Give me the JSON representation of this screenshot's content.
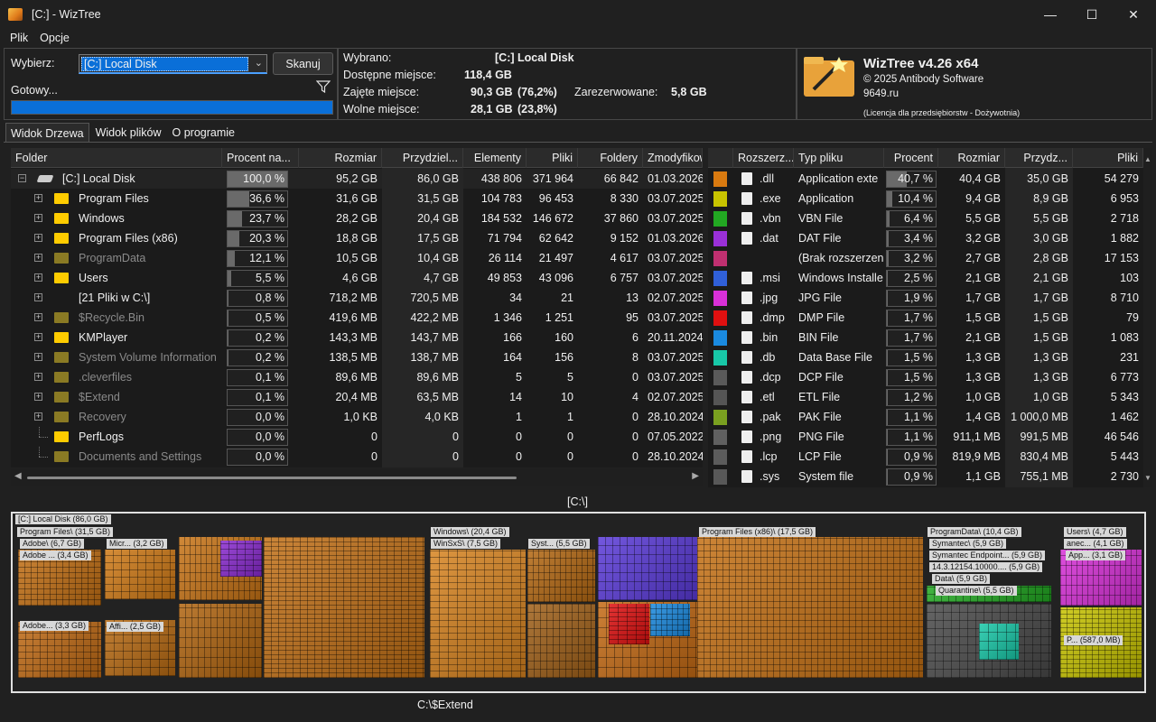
{
  "window": {
    "title": "[C:]  - WizTree",
    "minimize": "—",
    "maximize": "☐",
    "close": "✕"
  },
  "menu": [
    "Plik",
    "Opcje"
  ],
  "scan": {
    "select_label": "Wybierz:",
    "drive": "[C:] Local Disk",
    "scan_button": "Skanuj",
    "status": "Gotowy...",
    "progress": 1.0
  },
  "info": {
    "selected_label": "Wybrano:",
    "selected_drive": "[C:]",
    "selected_name": "Local Disk",
    "available_label": "Dostępne miejsce:",
    "available": "118,4 GB",
    "used_label": "Zajęte miejsce:",
    "used": "90,3 GB",
    "used_pct": "(76,2%)",
    "reserved_label": "Zarezerwowane:",
    "reserved": "5,8 GB",
    "free_label": "Wolne miejsce:",
    "free": "28,1 GB",
    "free_pct": "(23,8%)"
  },
  "about": {
    "title": "WizTree v4.26 x64",
    "copyright": "© 2025 Antibody Software",
    "site": "9649.ru",
    "license": "(Licencja dla przedsiębiorstw - Dożywotnia)"
  },
  "tabs": [
    "Widok Drzewa",
    "Widok plików",
    "O programie"
  ],
  "tree": {
    "columns": [
      "Folder",
      "Procent na...",
      "Rozmiar",
      "Przydziel...",
      "Elementy",
      "Pliki",
      "Foldery",
      "Zmodyfikow"
    ],
    "rows": [
      {
        "name": "[C:] Local Disk",
        "pct": "100,0 %",
        "pctv": 1.0,
        "size": "95,2 GB",
        "alloc": "86,0 GB",
        "items": "438 806",
        "files": "371 964",
        "folders": "66 842",
        "mod": "01.03.2026",
        "level": 0,
        "exp": "−",
        "icon": "drive",
        "dim": false
      },
      {
        "name": "Program Files",
        "pct": "36,6 %",
        "pctv": 0.366,
        "size": "31,6 GB",
        "alloc": "31,5 GB",
        "items": "104 783",
        "files": "96 453",
        "folders": "8 330",
        "mod": "03.07.2025",
        "level": 1,
        "exp": "+",
        "icon": "folder",
        "dim": false
      },
      {
        "name": "Windows",
        "pct": "23,7 %",
        "pctv": 0.237,
        "size": "28,2 GB",
        "alloc": "20,4 GB",
        "items": "184 532",
        "files": "146 672",
        "folders": "37 860",
        "mod": "03.07.2025",
        "level": 1,
        "exp": "+",
        "icon": "folder",
        "dim": false
      },
      {
        "name": "Program Files (x86)",
        "pct": "20,3 %",
        "pctv": 0.203,
        "size": "18,8 GB",
        "alloc": "17,5 GB",
        "items": "71 794",
        "files": "62 642",
        "folders": "9 152",
        "mod": "01.03.2026",
        "level": 1,
        "exp": "+",
        "icon": "folder",
        "dim": false
      },
      {
        "name": "ProgramData",
        "pct": "12,1 %",
        "pctv": 0.121,
        "size": "10,5 GB",
        "alloc": "10,4 GB",
        "items": "26 114",
        "files": "21 497",
        "folders": "4 617",
        "mod": "03.07.2025",
        "level": 1,
        "exp": "+",
        "icon": "folder",
        "dim": true
      },
      {
        "name": "Users",
        "pct": "5,5 %",
        "pctv": 0.055,
        "size": "4,6 GB",
        "alloc": "4,7 GB",
        "items": "49 853",
        "files": "43 096",
        "folders": "6 757",
        "mod": "03.07.2025",
        "level": 1,
        "exp": "+",
        "icon": "folder",
        "dim": false
      },
      {
        "name": "[21 Pliki w C:\\]",
        "pct": "0,8 %",
        "pctv": 0.008,
        "size": "718,2 MB",
        "alloc": "720,5 MB",
        "items": "34",
        "files": "21",
        "folders": "13",
        "mod": "02.07.2025",
        "level": 1,
        "exp": "+",
        "icon": "none",
        "dim": false
      },
      {
        "name": "$Recycle.Bin",
        "pct": "0,5 %",
        "pctv": 0.005,
        "size": "419,6 MB",
        "alloc": "422,2 MB",
        "items": "1 346",
        "files": "1 251",
        "folders": "95",
        "mod": "03.07.2025",
        "level": 1,
        "exp": "+",
        "icon": "sys",
        "dim": true
      },
      {
        "name": "KMPlayer",
        "pct": "0,2 %",
        "pctv": 0.002,
        "size": "143,3 MB",
        "alloc": "143,7 MB",
        "items": "166",
        "files": "160",
        "folders": "6",
        "mod": "20.11.2024",
        "level": 1,
        "exp": "+",
        "icon": "folder",
        "dim": false
      },
      {
        "name": "System Volume Information",
        "pct": "0,2 %",
        "pctv": 0.002,
        "size": "138,5 MB",
        "alloc": "138,7 MB",
        "items": "164",
        "files": "156",
        "folders": "8",
        "mod": "03.07.2025",
        "level": 1,
        "exp": "+",
        "icon": "sys",
        "dim": true
      },
      {
        "name": ".cleverfiles",
        "pct": "0,1 %",
        "pctv": 0.001,
        "size": "89,6 MB",
        "alloc": "89,6 MB",
        "items": "5",
        "files": "5",
        "folders": "0",
        "mod": "03.07.2025",
        "level": 1,
        "exp": "+",
        "icon": "folder",
        "dim": true
      },
      {
        "name": "$Extend",
        "pct": "0,1 %",
        "pctv": 0.001,
        "size": "20,4 MB",
        "alloc": "63,5 MB",
        "items": "14",
        "files": "10",
        "folders": "4",
        "mod": "02.07.2025",
        "level": 1,
        "exp": "+",
        "icon": "sys",
        "dim": true
      },
      {
        "name": "Recovery",
        "pct": "0,0 %",
        "pctv": 0.0,
        "size": "1,0 KB",
        "alloc": "4,0 KB",
        "items": "1",
        "files": "1",
        "folders": "0",
        "mod": "28.10.2024",
        "level": 1,
        "exp": "+",
        "icon": "folder",
        "dim": true
      },
      {
        "name": "PerfLogs",
        "pct": "0,0 %",
        "pctv": 0.0,
        "size": "0",
        "alloc": "0",
        "items": "0",
        "files": "0",
        "folders": "0",
        "mod": "07.05.2022",
        "level": 1,
        "exp": "",
        "icon": "folder",
        "dim": false
      },
      {
        "name": "Documents and Settings",
        "pct": "0,0 %",
        "pctv": 0.0,
        "size": "0",
        "alloc": "0",
        "items": "0",
        "files": "0",
        "folders": "0",
        "mod": "28.10.2024",
        "level": 1,
        "exp": "",
        "icon": "sys",
        "dim": true
      }
    ]
  },
  "ext": {
    "columns": [
      "Rozszerz...",
      "Typ pliku",
      "Procent",
      "Rozmiar",
      "Przydz...",
      "Pliki"
    ],
    "rows": [
      {
        "ext": ".dll",
        "type": "Application exte",
        "pct": "40,7 %",
        "pctv": 0.407,
        "size": "40,4 GB",
        "alloc": "35,0 GB",
        "files": "54 279",
        "color": "#d97a10"
      },
      {
        "ext": ".exe",
        "type": "Application",
        "pct": "10,4 %",
        "pctv": 0.104,
        "size": "9,4 GB",
        "alloc": "8,9 GB",
        "files": "6 953",
        "color": "#c8c400"
      },
      {
        "ext": ".vbn",
        "type": "VBN File",
        "pct": "6,4 %",
        "pctv": 0.064,
        "size": "5,5 GB",
        "alloc": "5,5 GB",
        "files": "2 718",
        "color": "#22a822"
      },
      {
        "ext": ".dat",
        "type": "DAT File",
        "pct": "3,4 %",
        "pctv": 0.034,
        "size": "3,2 GB",
        "alloc": "3,0 GB",
        "files": "1 882",
        "color": "#9a30d8"
      },
      {
        "ext": "",
        "type": "(Brak rozszerzeni",
        "pct": "3,2 %",
        "pctv": 0.032,
        "size": "2,7 GB",
        "alloc": "2,8 GB",
        "files": "17 153",
        "color": "#c03070"
      },
      {
        "ext": ".msi",
        "type": "Windows Installe",
        "pct": "2,5 %",
        "pctv": 0.025,
        "size": "2,1 GB",
        "alloc": "2,1 GB",
        "files": "103",
        "color": "#3060d8"
      },
      {
        "ext": ".jpg",
        "type": "JPG File",
        "pct": "1,9 %",
        "pctv": 0.019,
        "size": "1,7 GB",
        "alloc": "1,7 GB",
        "files": "8 710",
        "color": "#d830d8"
      },
      {
        "ext": ".dmp",
        "type": "DMP File",
        "pct": "1,7 %",
        "pctv": 0.017,
        "size": "1,5 GB",
        "alloc": "1,5 GB",
        "files": "79",
        "color": "#e01010"
      },
      {
        "ext": ".bin",
        "type": "BIN File",
        "pct": "1,7 %",
        "pctv": 0.017,
        "size": "2,1 GB",
        "alloc": "1,5 GB",
        "files": "1 083",
        "color": "#1a8ae0"
      },
      {
        "ext": ".db",
        "type": "Data Base File",
        "pct": "1,5 %",
        "pctv": 0.015,
        "size": "1,3 GB",
        "alloc": "1,3 GB",
        "files": "231",
        "color": "#18c8a8"
      },
      {
        "ext": ".dcp",
        "type": "DCP File",
        "pct": "1,5 %",
        "pctv": 0.015,
        "size": "1,3 GB",
        "alloc": "1,3 GB",
        "files": "6 773",
        "color": "#5a5a5a"
      },
      {
        "ext": ".etl",
        "type": "ETL File",
        "pct": "1,2 %",
        "pctv": 0.012,
        "size": "1,0 GB",
        "alloc": "1,0 GB",
        "files": "5 343",
        "color": "#555555"
      },
      {
        "ext": ".pak",
        "type": "PAK File",
        "pct": "1,1 %",
        "pctv": 0.011,
        "size": "1,4 GB",
        "alloc": "1 000,0 MB",
        "files": "1 462",
        "color": "#7aa020"
      },
      {
        "ext": ".png",
        "type": "PNG File",
        "pct": "1,1 %",
        "pctv": 0.011,
        "size": "911,1 MB",
        "alloc": "991,5 MB",
        "files": "46 546",
        "color": "#606060"
      },
      {
        "ext": ".lcp",
        "type": "LCP File",
        "pct": "0,9 %",
        "pctv": 0.009,
        "size": "819,9 MB",
        "alloc": "830,4 MB",
        "files": "5 443",
        "color": "#5c5c5c"
      },
      {
        "ext": ".sys",
        "type": "System file",
        "pct": "0,9 %",
        "pctv": 0.009,
        "size": "1,1 GB",
        "alloc": "755,1 MB",
        "files": "2 730",
        "color": "#585858"
      }
    ]
  },
  "treemap_title": "[C:\\]",
  "treemap_labels": {
    "root": "[C:] Local Disk  (86,0 GB)",
    "pf": "Program Files\\ (31,5 GB)",
    "adobe": "Adobe\\ (6,7 GB)",
    "adobe1": "Adobe ... (3,4 GB)",
    "adobe2": "Adobe... (3,3 GB)",
    "micr": "Micr... (3,2 GB)",
    "affi": "Affi... (2,5 GB)",
    "win": "Windows\\ (20,4 GB)",
    "winsxs": "WinSxS\\ (7,5 GB)",
    "syst": "Syst... (5,5 GB)",
    "pf86": "Program Files (x86)\\ (17,5 GB)",
    "pd": "ProgramData\\ (10,4 GB)",
    "sym": "Symantec\\ (5,9 GB)",
    "symep": "Symantec Endpoint... (5,9 GB)",
    "ver": "14.3.12154.10000.... (5,9 GB)",
    "data": "Data\\ (5,9 GB)",
    "quar": "Quarantine\\ (5,5 GB)",
    "users": "Users\\ (4,7 GB)",
    "anec": "anec... (4,1 GB)",
    "app": "App... (3,1 GB)",
    "p": "P... (587,0 MB)"
  },
  "status_path": "C:\\$Extend",
  "colors": {
    "accent": "#0a6fd8",
    "bg": "#202020",
    "folder": "#ffcc00"
  }
}
